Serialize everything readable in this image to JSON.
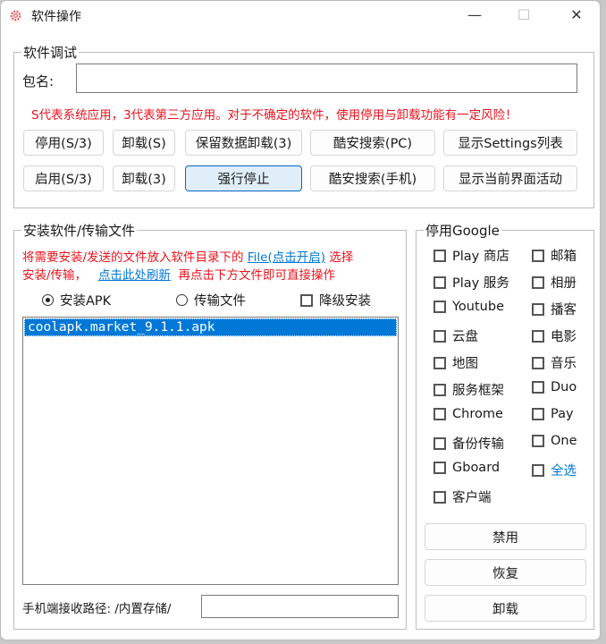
{
  "window": {
    "title": "软件操作",
    "minimize": "—",
    "maximize": "☐",
    "close": "✕",
    "accent": "#0078d4"
  },
  "debug": {
    "legend": "软件调试",
    "package_label": "包名:",
    "package_value": "",
    "warning": "S代表系统应用，3代表第三方应用。对于不确定的软件，使用停用与卸载功能有一定风险！",
    "buttons_row1": [
      "停用(S/3)",
      "卸载(S)",
      "保留数据卸载(3)",
      "酷安搜索(PC)",
      "显示Settings列表"
    ],
    "buttons_row2": [
      "启用(S/3)",
      "卸载(3)",
      "强行停止",
      "酷安搜索(手机)",
      "显示当前界面活动"
    ]
  },
  "install": {
    "legend": "安装软件/传输文件",
    "hint1": "将需要安装/发送的文件放入软件目录下的",
    "link_file": "File(点击开启)",
    "hint2": "选择",
    "hint3": "安装/传输，",
    "link_refresh": "点击此处刷新",
    "hint4": "再点击下方文件即可直接操作",
    "radio_apk": "安装APK",
    "radio_transfer": "传输文件",
    "checkbox_downgrade": "降级安装",
    "files": [
      "coolapk.market_9.1.1.apk"
    ],
    "path_label": "手机端接收路径: /内置存储/",
    "path_value": ""
  },
  "google": {
    "legend": "停用Google",
    "col1": [
      "Play 商店",
      "Play 服务",
      "Youtube",
      "云盘",
      "地图",
      "服务框架",
      "Chrome",
      "备份传输",
      "Gboard",
      "客户端"
    ],
    "col2": [
      "邮箱",
      "相册",
      "播客",
      "电影",
      "音乐",
      "Duo",
      "Pay",
      "One",
      "全选"
    ],
    "buttons": [
      "禁用",
      "恢复",
      "卸载"
    ]
  }
}
